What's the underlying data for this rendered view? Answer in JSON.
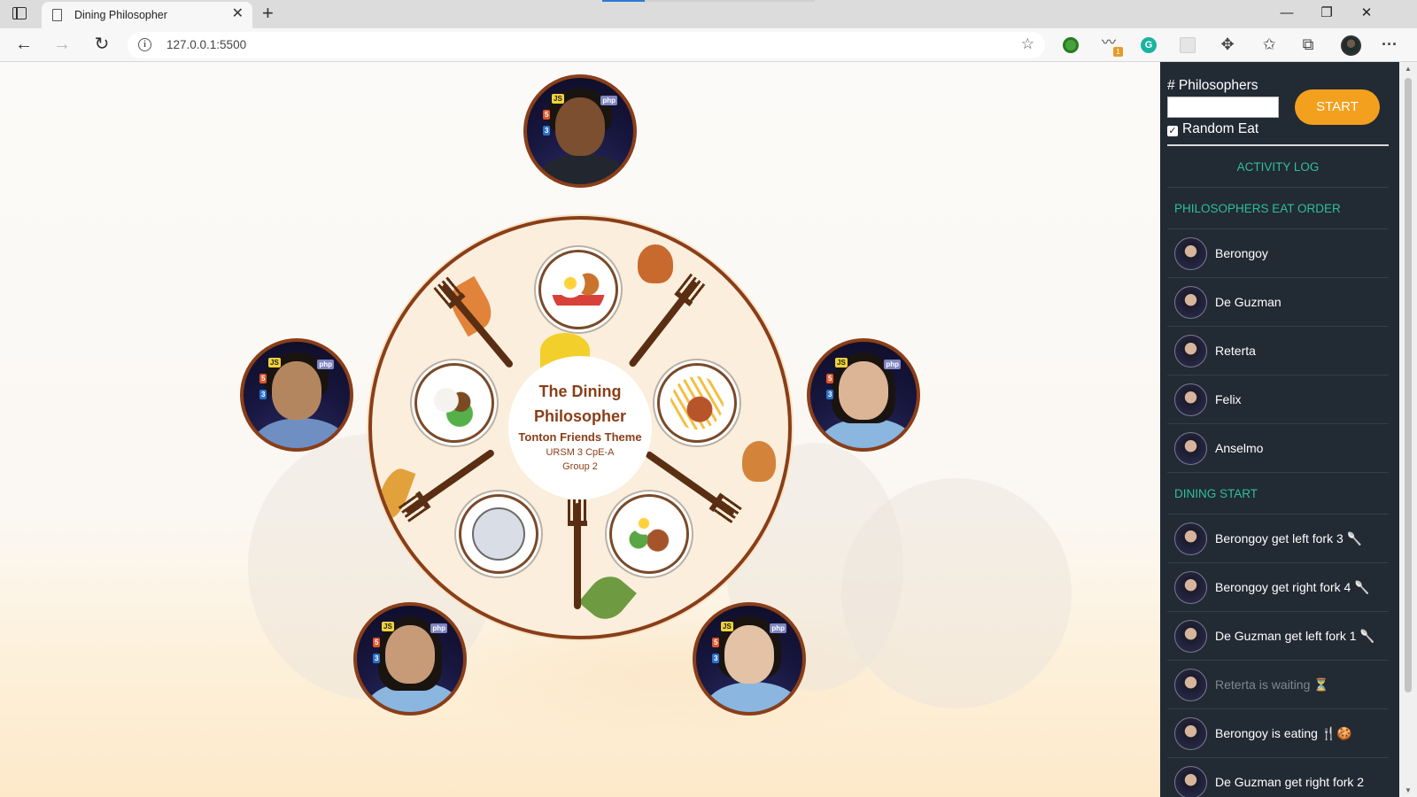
{
  "browser": {
    "tab_title": "Dining Philosopher",
    "tab_close": "✕",
    "new_tab": "+",
    "url": "127.0.0.1:5500",
    "window": {
      "minimize": "—",
      "restore": "❐",
      "close": "✕"
    },
    "nav": {
      "back": "←",
      "forward": "→",
      "reload": "↻"
    },
    "info": "i",
    "favorite": "☆",
    "extension_badge": "1",
    "extension_grammarly": "G",
    "toolbar": {
      "extensions": "✥",
      "favorites": "✩",
      "collections": "⧉",
      "more": "···"
    }
  },
  "table": {
    "title": "The Dining Philosopher",
    "theme": "Tonton Friends Theme",
    "class": "URSM 3 CpE-A",
    "group": "Group 2"
  },
  "controls": {
    "philosophers_label": "# Philosophers",
    "philosophers_value": "",
    "random_eat_label": "Random Eat",
    "random_eat_checked": true,
    "start_label": "START"
  },
  "log": {
    "header": "ACTIVITY LOG",
    "order_header": "PHILOSOPHERS EAT ORDER",
    "order": [
      "Berongoy",
      "De Guzman",
      "Reterta",
      "Felix",
      "Anselmo"
    ],
    "dining_header": "DINING START",
    "events": [
      {
        "text": "Berongoy get left fork 3 🥄",
        "dim": false
      },
      {
        "text": "Berongoy get right fork 4 🥄",
        "dim": false
      },
      {
        "text": "De Guzman get left fork 1 🥄",
        "dim": false
      },
      {
        "text": "Reterta is waiting ⏳",
        "dim": true
      },
      {
        "text": "Berongoy is eating 🍴🍪",
        "dim": false
      },
      {
        "text": "De Guzman get right fork 2",
        "dim": false
      }
    ]
  },
  "colors": {
    "accent": "#f2a01e",
    "table_border": "#8a3e18",
    "sidebar_bg": "#222a33",
    "log_header": "#2fbf9b"
  },
  "icons": {
    "sidebar_toggle": "sidebar-toggle-icon",
    "page": "page-icon",
    "info": "info-icon",
    "favorite": "star-add-icon",
    "extensions": "puzzle-icon",
    "favorites": "favorites-icon",
    "collections": "collections-icon",
    "more": "more-icon"
  }
}
